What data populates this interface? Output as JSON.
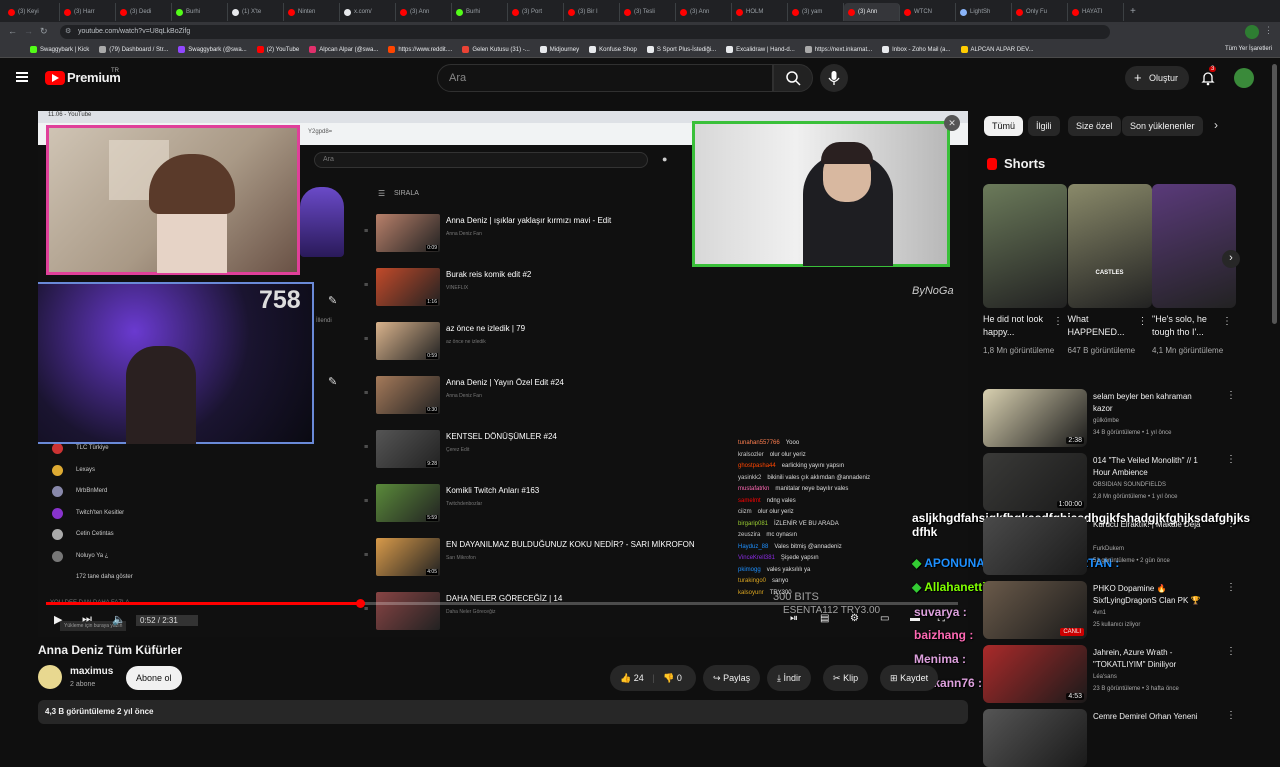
{
  "browser": {
    "tabs": [
      {
        "label": "(3) Keyi",
        "color": "#ff0000"
      },
      {
        "label": "(3) Harr",
        "color": "#ff0000"
      },
      {
        "label": "(3) Dedi",
        "color": "#ff0000"
      },
      {
        "label": "Burhi",
        "color": "#53fc18"
      },
      {
        "label": "(1) X'te",
        "color": "#e8eaed"
      },
      {
        "label": "Ninten",
        "color": "#ff0000"
      },
      {
        "label": "x.com/",
        "color": "#e8eaed"
      },
      {
        "label": "(3) Ann",
        "color": "#ff0000"
      },
      {
        "label": "Burhi",
        "color": "#53fc18"
      },
      {
        "label": "(3) Port",
        "color": "#ff0000"
      },
      {
        "label": "(3) Bir I",
        "color": "#ff0000"
      },
      {
        "label": "(3) Tesli",
        "color": "#ff0000"
      },
      {
        "label": "(3) Ann",
        "color": "#ff0000"
      },
      {
        "label": "HOLM",
        "color": "#ff0000"
      },
      {
        "label": "(3) yam",
        "color": "#ff0000"
      },
      {
        "label": "(3) Ann",
        "color": "#ff0000",
        "active": true
      },
      {
        "label": "WTCN",
        "color": "#ff0000"
      },
      {
        "label": "LightSh",
        "color": "#8ab4f8"
      },
      {
        "label": "Only Fu",
        "color": "#ff0000"
      },
      {
        "label": "HAYATI",
        "color": "#ff0000"
      }
    ],
    "url": "youtube.com/watch?v=U8qLkBoZifg",
    "bookmarks": [
      {
        "label": "Swaggybark | Kick",
        "color": "#53fc18"
      },
      {
        "label": "(79) Dashboard / Str...",
        "color": "#aaa"
      },
      {
        "label": "Swaggybark (@swa...",
        "color": "#9147ff"
      },
      {
        "label": "(2) YouTube",
        "color": "#ff0000"
      },
      {
        "label": "Alpcan Alpar (@swa...",
        "color": "#e1306c"
      },
      {
        "label": "https://www.reddit....",
        "color": "#ff4500"
      },
      {
        "label": "Gelen Kutusu (31) -...",
        "color": "#ea4335"
      },
      {
        "label": "Midjourney",
        "color": "#e8eaed"
      },
      {
        "label": "Konfuse Shop",
        "color": "#e8eaed"
      },
      {
        "label": "S Sport Plus-İstediği...",
        "color": "#e8eaed"
      },
      {
        "label": "Excalidraw | Hand-d...",
        "color": "#e8eaed"
      },
      {
        "label": "https://next.inkarnat...",
        "color": "#aaa"
      },
      {
        "label": "Inbox - Zoho Mail (a...",
        "color": "#e8eaed"
      },
      {
        "label": "ALPCAN ALPAR DEV...",
        "color": "#ffcc00"
      }
    ],
    "all_bookmarks": "Tüm Yer İşaretleri"
  },
  "header": {
    "logo": "Premium",
    "logo_sup": "TR",
    "search_placeholder": "Ara",
    "create_label": "Oluştur",
    "notif_count": "3"
  },
  "player": {
    "viewer_count": "758",
    "watermark": "ByNoGa",
    "time": "0:52 / 2:31",
    "overlay": {
      "inner_tab": "11.06 - YouTube",
      "inner_url": "Y2gpd8=",
      "inner_search": "Ara",
      "sort_label": "SIRALA",
      "left_text": "İllendi",
      "recommend_title": "YOU DEE DAN DAHA FAZLA",
      "recommend_sub": "Yükleme için buraya yazın",
      "sidebar": [
        "TLC Türkiye",
        "Lexays",
        "MrbBnMerd",
        "Twitch'ten Kesitler",
        "Cetin Cetintas",
        "Noluyo Ya ¿",
        "172 tane daha göster"
      ],
      "list": [
        {
          "title": "Anna Deniz | ışıklar yaklaşır kırmızı mavi - Edit",
          "channel": "Anna Deniz Fan",
          "dur": "0:09",
          "color": "#b8806a"
        },
        {
          "title": "Burak reis komik edit #2",
          "channel": "VINEFLIX",
          "dur": "1:16",
          "color": "#c24a2a"
        },
        {
          "title": "az önce ne izledik | 79",
          "channel": "az önce ne izledik",
          "dur": "0:59",
          "color": "#d9b38c"
        },
        {
          "title": "Anna Deniz | Yayın Özel Edit #24",
          "channel": "Anna Deniz Fan",
          "dur": "0:30",
          "color": "#a57a5a"
        },
        {
          "title": "KENTSEL DÖNÜŞÜMLER #24",
          "channel": "Çerez Edit",
          "dur": "9:28",
          "color": "#555"
        },
        {
          "title": "Komikli Twitch Anları #163",
          "channel": "Twitchdenbozlar",
          "dur": "5:59",
          "color": "#5a8a3a"
        },
        {
          "title": "EN DAYANILMAZ BULDUĞUNUZ KOKU NEDİR? - SARI MİKROFON",
          "channel": "Sarı Mikrofon",
          "dur": "4:05",
          "color": "#d89a4a"
        },
        {
          "title": "DAHA NELER GÖRECEĞİZ | 14",
          "channel": "Daha Neler Göreceğiz",
          "dur": "",
          "color": "#884444"
        }
      ],
      "chat": [
        {
          "user": "tunahan557766",
          "msg": "Yooo",
          "color": "#ff7f50"
        },
        {
          "user": "kralsozler",
          "msg": "olur olur yeriz",
          "color": "#cccccc"
        },
        {
          "user": "ghostpasha44",
          "msg": "earlicking yayını yapsın",
          "color": "#ff4500"
        },
        {
          "user": "yasinkk2",
          "msg": "bikinili vales çık aklımdan @annadeniz",
          "color": "#cccccc"
        },
        {
          "user": "mustafatrkn",
          "msg": "manitalar neye bayılır vales",
          "color": "#ff69b4"
        },
        {
          "user": "samelmt",
          "msg": "ndng vales",
          "color": "#ff0000"
        },
        {
          "user": "ciizm",
          "msg": "olur olur yeriz",
          "color": "#cccccc"
        },
        {
          "user": "birgarip081",
          "msg": "İZLENİR VE BU ARADA",
          "color": "#9acd32"
        },
        {
          "user": "zeuszira",
          "msg": "mc oynasın",
          "color": "#cccccc"
        },
        {
          "user": "Hayduz_88",
          "msg": "Vales bitmiş @annadeniz",
          "color": "#1e90ff"
        },
        {
          "user": "VinceKrell381",
          "msg": "Şişede yapsın",
          "color": "#8a2be2"
        },
        {
          "user": "pkimogg",
          "msg": "vales yaksılılı ya",
          "color": "#1e90ff"
        },
        {
          "user": "turakingo0",
          "msg": "sarıyo",
          "color": "#daa520"
        },
        {
          "user": "kalsoyunr",
          "msg": "TRY300",
          "color": "#daa520"
        }
      ],
      "donation_1": "ESENTA112  TRY3.00",
      "donation_2": "300 BITS"
    },
    "stream_chat": [
      {
        "user": "",
        "msg": "asljkhgdfahsjgkfhgkasdfghjasdhgjkfshadgjkfghjksdafghjks dfhk",
        "color": "#ffffff"
      },
      {
        "user": "APONUNANASININAMINIYIRTAN :",
        "msg": "",
        "color": "#1e90ff"
      },
      {
        "user": "Allahanettin_Seriatcioglu :",
        "msg": "",
        "color": "#7fff00"
      },
      {
        "user": "suvarya :",
        "msg": "",
        "color": "#dda0dd"
      },
      {
        "user": "baizhang :",
        "msg": "",
        "color": "#ff69b4"
      },
      {
        "user": "Menima :",
        "msg": "",
        "color": "#dda0dd"
      },
      {
        "user": "Serkann76 :",
        "msg": "",
        "color": "#dda0dd"
      }
    ]
  },
  "video": {
    "title": "Anna Deniz Tüm Küfürler",
    "channel": "maximus",
    "subs": "2 abone",
    "subscribe": "Abone ol",
    "likes": "24",
    "dislikes": "0",
    "share": "Paylaş",
    "download": "İndir",
    "clip": "Klip",
    "save": "Kaydet",
    "views_line": "4,3 B görüntüleme  2 yıl önce"
  },
  "right": {
    "chips": [
      "Tümü",
      "İlgili",
      "Size özel",
      "Son yüklenenler"
    ],
    "shorts_header": "Shorts",
    "shorts": [
      {
        "title": "He did not look happy...",
        "views": "1,8 Mn görüntüleme",
        "color": "#6b7a5a"
      },
      {
        "title": "What HAPPENED...",
        "views": "647 B görüntüleme",
        "color": "#8a8a6a",
        "caption": "CASTLES"
      },
      {
        "title": "\"He's solo, he tough tho I'...",
        "views": "4,1 Mn görüntüleme",
        "color": "#5a3a7a"
      }
    ],
    "videos": [
      {
        "title": "selam beyler ben kahraman kazor",
        "channel": "gülkömbe",
        "meta": "34 B görüntüleme • 1 yıl önce",
        "dur": "2:38",
        "color": "#d8d0b0"
      },
      {
        "title": "014 \"The Veiled Monolith\" // 1 Hour Ambience",
        "channel": "OBSIDIAN SOUNDFIELDS",
        "meta": "2,8 Mn görüntüleme • 1 yıl önce",
        "dur": "1:00:00",
        "color": "#3a3a38"
      },
      {
        "title": "Kurucu Elraktık! | Makale Deja",
        "channel": "FurkDukem",
        "meta": "51 görüntüleme • 2 gün önce",
        "dur": "",
        "color": "#4a4a4a"
      },
      {
        "title": "PHKO Dopamine 🔥 SixfLyingDragonS Clan PK 🏆",
        "channel": "4vn1",
        "meta": "25 kullanıcı izliyor",
        "dur": "",
        "live": "CANLI",
        "color": "#6a5a4a"
      },
      {
        "title": "Jahrein, Azure Wrath - \"TOKATLIYIM\" Diniliyor",
        "channel": "Léa'sans",
        "meta": "23 B görüntüleme • 3 hafta önce",
        "dur": "4:53",
        "color": "#aa2a2a"
      },
      {
        "title": "Cemre Demirel Orhan Yeneni",
        "channel": "",
        "meta": "",
        "dur": "",
        "color": "#555"
      }
    ]
  }
}
